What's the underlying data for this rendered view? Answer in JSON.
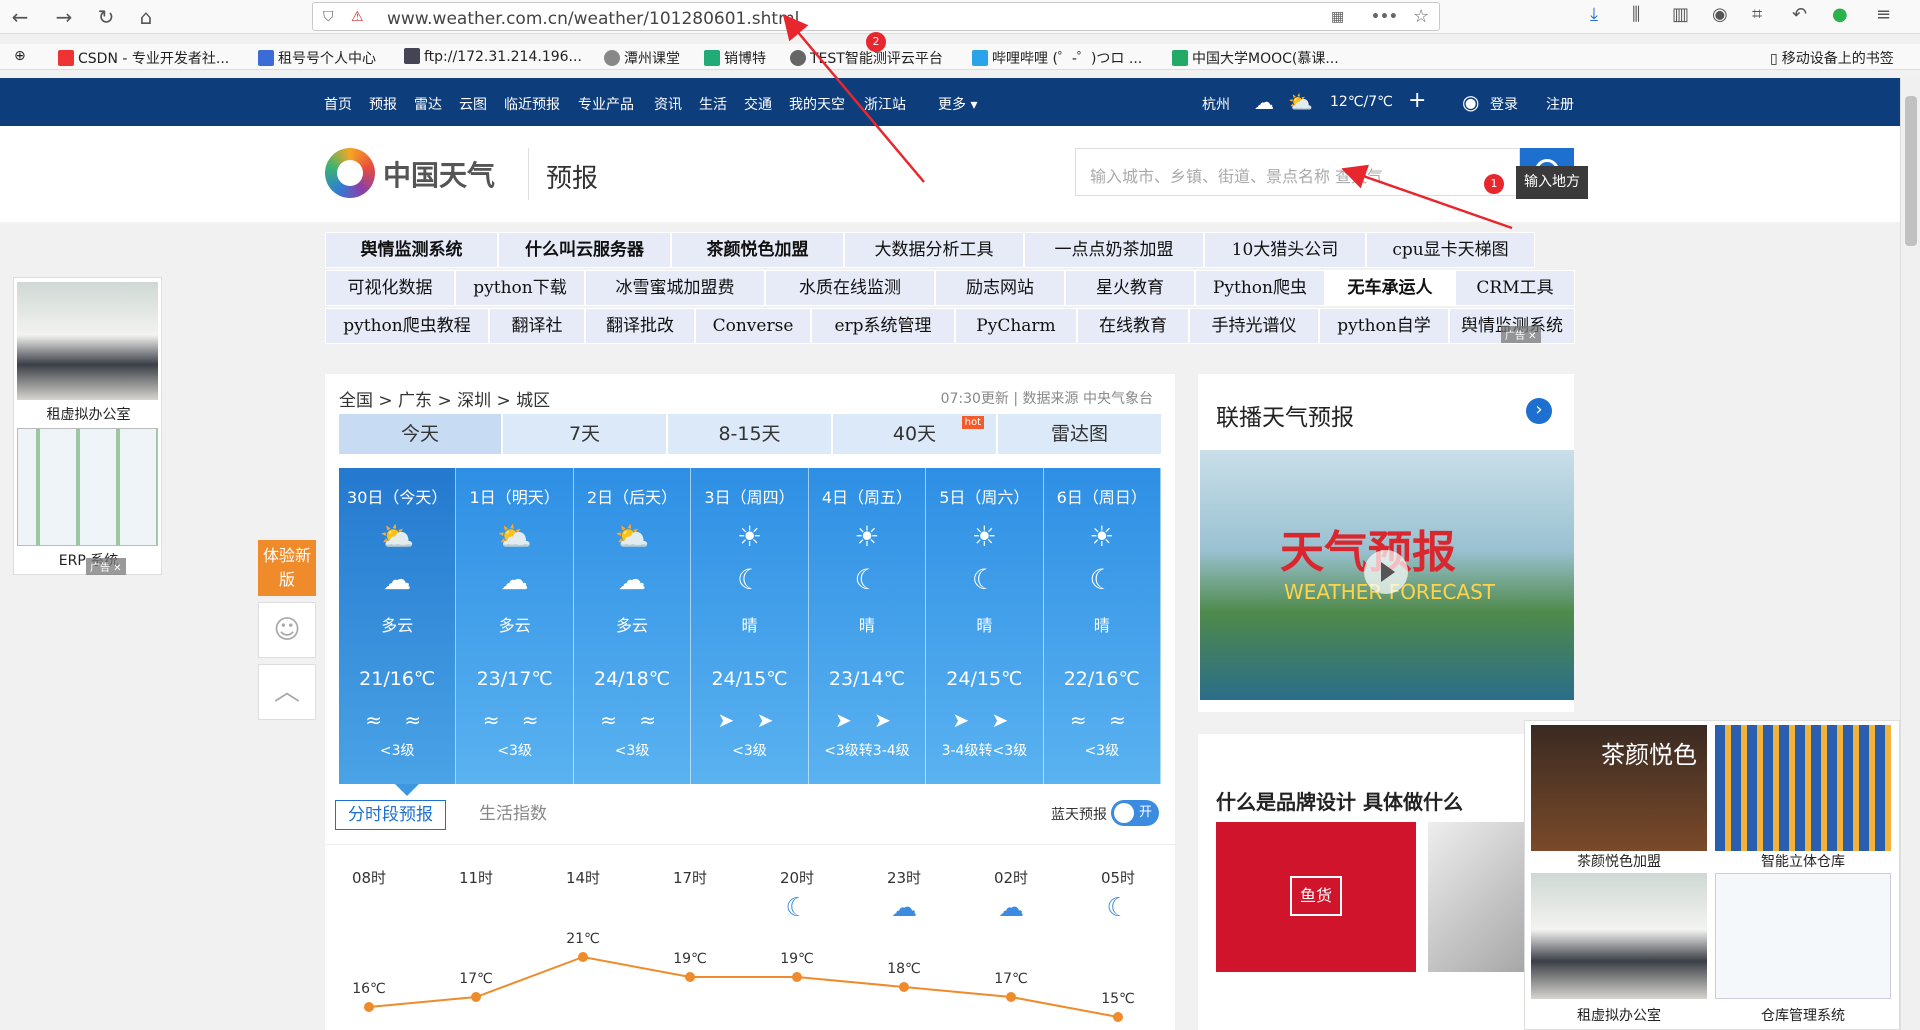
{
  "browser": {
    "url": "www.weather.com.cn/weather/101280601.shtml",
    "bookmarks": [
      {
        "label": "CSDN - 专业开发者社...",
        "color": "#e33"
      },
      {
        "label": "租号号个人中心",
        "color": "#3b6bd6"
      },
      {
        "label": "ftp://172.31.214.196...",
        "color": "#445"
      },
      {
        "label": "潭州课堂",
        "color": "#888"
      },
      {
        "label": "销博特",
        "color": "#2a7"
      },
      {
        "label": "TEST智能测评云平台",
        "color": "#666"
      },
      {
        "label": "哔哩哔哩 (゜-゜)つロ ...",
        "color": "#2aa4e8"
      },
      {
        "label": "中国大学MOOC(慕课...",
        "color": "#2a6"
      }
    ],
    "mobile_bookmarks": "移动设备上的书签"
  },
  "site_nav": {
    "items": [
      "首页",
      "预报",
      "雷达",
      "云图",
      "临近预报",
      "专业产品",
      "资讯",
      "生活",
      "交通",
      "我的天空",
      "浙江站",
      "更多 ▾"
    ],
    "city": "杭州",
    "city_temp": "12℃/7℃",
    "plus": "+",
    "login": "登录",
    "register": "注册"
  },
  "header": {
    "logo": "中国天气",
    "subtitle": "预报",
    "search_placeholder": "输入城市、乡镇、街道、景点名称 查天气",
    "tooltip": "输入地方"
  },
  "annotations": {
    "badge1": "1",
    "badge2": "2"
  },
  "ads": {
    "row1": [
      "舆情监测系统",
      "什么叫云服务器",
      "茶颜悦色加盟",
      "大数据分析工具",
      "一点点奶茶加盟",
      "10大猎头公司",
      "cpu显卡天梯图"
    ],
    "row2": [
      "可视化数据",
      "python下载",
      "冰雪蜜城加盟费",
      "水质在线监测",
      "励志网站",
      "星火教育",
      "Python爬虫",
      "无车承运人",
      "CRM工具"
    ],
    "row3": [
      "python爬虫教程",
      "翻译社",
      "翻译批改",
      "Converse",
      "erp系统管理",
      "PyCharm",
      "在线教育",
      "手持光谱仪",
      "python自学",
      "舆情监测系统"
    ],
    "ad_mark": "广告 ✕"
  },
  "left_ad": {
    "cap1": "租虚拟办公室",
    "cap2": "ERP 系统",
    "mark": "广告 ✕"
  },
  "side": {
    "new_version": "体验新版",
    "smile_icon": "☺",
    "top_icon": "︿"
  },
  "forecast": {
    "breadcrumb": "全国 > 广东 > 深圳 > 城区",
    "update": "07:30更新 | 数据来源 中央气象台",
    "tabs": [
      "今天",
      "7天",
      "8-15天",
      "40天",
      "雷达图"
    ],
    "hot": "hot",
    "days": [
      {
        "date": "30日（今天）",
        "desc": "多云",
        "temp": "21/16℃",
        "wind": "<3级",
        "icon1": "⛅",
        "icon2": "☁",
        "wind_icon": "≈ ≈"
      },
      {
        "date": "1日（明天）",
        "desc": "多云",
        "temp": "23/17℃",
        "wind": "<3级",
        "icon1": "⛅",
        "icon2": "☁",
        "wind_icon": "≈ ≈"
      },
      {
        "date": "2日（后天）",
        "desc": "多云",
        "temp": "24/18℃",
        "wind": "<3级",
        "icon1": "⛅",
        "icon2": "☁",
        "wind_icon": "≈ ≈"
      },
      {
        "date": "3日（周四）",
        "desc": "晴",
        "temp": "24/15℃",
        "wind": "<3级",
        "icon1": "☀",
        "icon2": "☾",
        "wind_icon": "➤ ➤"
      },
      {
        "date": "4日（周五）",
        "desc": "晴",
        "temp": "23/14℃",
        "wind": "<3级转3-4级",
        "icon1": "☀",
        "icon2": "☾",
        "wind_icon": "➤ ➤"
      },
      {
        "date": "5日（周六）",
        "desc": "晴",
        "temp": "24/15℃",
        "wind": "3-4级转<3级",
        "icon1": "☀",
        "icon2": "☾",
        "wind_icon": "➤ ➤"
      },
      {
        "date": "6日（周日）",
        "desc": "晴",
        "temp": "22/16℃",
        "wind": "<3级",
        "icon1": "☀",
        "icon2": "☾",
        "wind_icon": "≈ ≈"
      }
    ],
    "subtab_active": "分时段预报",
    "subtab_other": "生活指数",
    "blue_sky": "蓝天预报",
    "toggle": "开",
    "hours": [
      {
        "time": "08时",
        "icon": "",
        "temp": "16℃",
        "t": 16
      },
      {
        "time": "11时",
        "icon": "",
        "temp": "17℃",
        "t": 17
      },
      {
        "time": "14时",
        "icon": "",
        "temp": "21℃",
        "t": 21
      },
      {
        "time": "17时",
        "icon": "",
        "temp": "19℃",
        "t": 19
      },
      {
        "time": "20时",
        "icon": "☾",
        "temp": "19℃",
        "t": 19
      },
      {
        "time": "23时",
        "icon": "☁",
        "temp": "18℃",
        "t": 18
      },
      {
        "time": "02时",
        "icon": "☁",
        "temp": "17℃",
        "t": 17
      },
      {
        "time": "05时",
        "icon": "☾",
        "temp": "15℃",
        "t": 15
      }
    ]
  },
  "right": {
    "title": "联播天气预报",
    "arrow": "›",
    "video_title": "天气预报",
    "video_sub": "WEATHER FORECAST",
    "card2_title": "什么是品牌设计 具体做什么",
    "brand": "鱼货"
  },
  "float_ad": {
    "caps": [
      "茶颜悦色加盟",
      "智能立体仓库",
      "租虚拟办公室",
      "仓库管理系统"
    ],
    "brand_text": "茶颜悦色"
  }
}
